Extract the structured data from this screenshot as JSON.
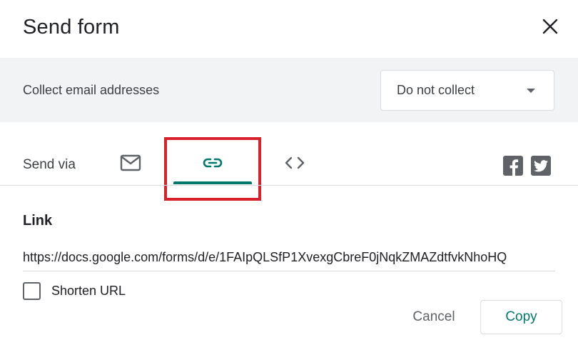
{
  "dialog": {
    "title": "Send form",
    "close_icon": "close-icon"
  },
  "collect": {
    "label": "Collect email addresses",
    "selected": "Do not collect"
  },
  "send_via": {
    "label": "Send via",
    "tabs": [
      {
        "icon": "email-icon"
      },
      {
        "icon": "link-icon",
        "active": true
      },
      {
        "icon": "embed-code-icon"
      }
    ],
    "social": [
      {
        "icon": "facebook-icon"
      },
      {
        "icon": "twitter-icon"
      }
    ]
  },
  "link": {
    "heading": "Link",
    "url": "https://docs.google.com/forms/d/e/1FAIpQLSfP1XvexgCbreF0jNqkZMAZdtfvkNhoHQ",
    "shorten_label": "Shorten URL",
    "shorten_checked": false
  },
  "actions": {
    "cancel_label": "Cancel",
    "copy_label": "Copy"
  },
  "colors": {
    "accent": "#00796b",
    "highlight": "#d9212c",
    "bar_bg": "#f1f3f4"
  }
}
